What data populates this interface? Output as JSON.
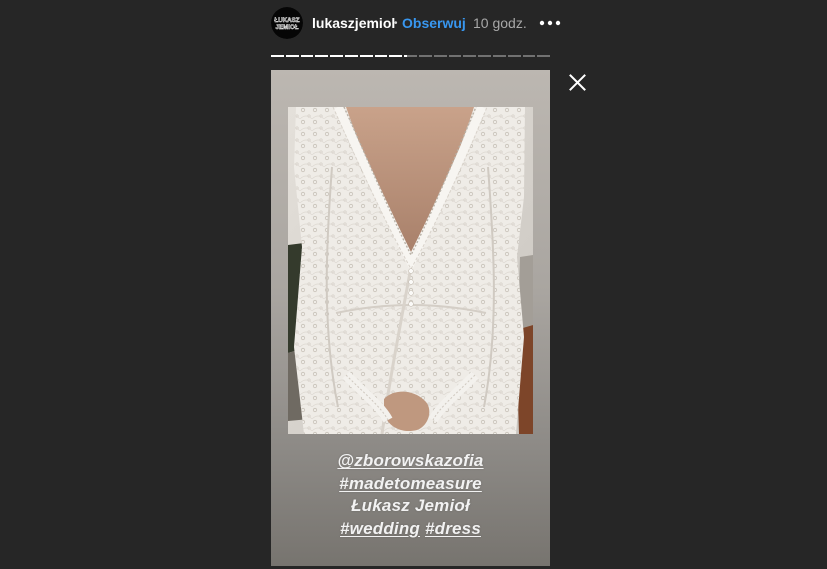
{
  "header": {
    "username": "lukaszjemiol",
    "separator": "•",
    "follow_label": "Obserwuj",
    "timestamp": "10 godz.",
    "more_icon": "more-horizontal-icon"
  },
  "avatar": {
    "logo_lines": [
      "ŁUKASZ",
      "JEMIOŁ"
    ]
  },
  "progress": {
    "total_segments": 19,
    "viewed_segments": 9,
    "current_progress": 0.25
  },
  "story": {
    "caption_lines": [
      [
        {
          "text": "@zborowskazofia",
          "type": "mention"
        }
      ],
      [
        {
          "text": "#madetomeasure",
          "type": "hashtag"
        }
      ],
      [
        {
          "text": "Łukasz Jemioł",
          "type": "text"
        }
      ],
      [
        {
          "text": "#wedding",
          "type": "hashtag"
        },
        {
          "text": "#dress",
          "type": "hashtag"
        }
      ]
    ]
  },
  "close_icon": "close-icon",
  "colors": {
    "background": "#262626",
    "follow": "#3897f0",
    "muted": "#a8a8a8"
  }
}
